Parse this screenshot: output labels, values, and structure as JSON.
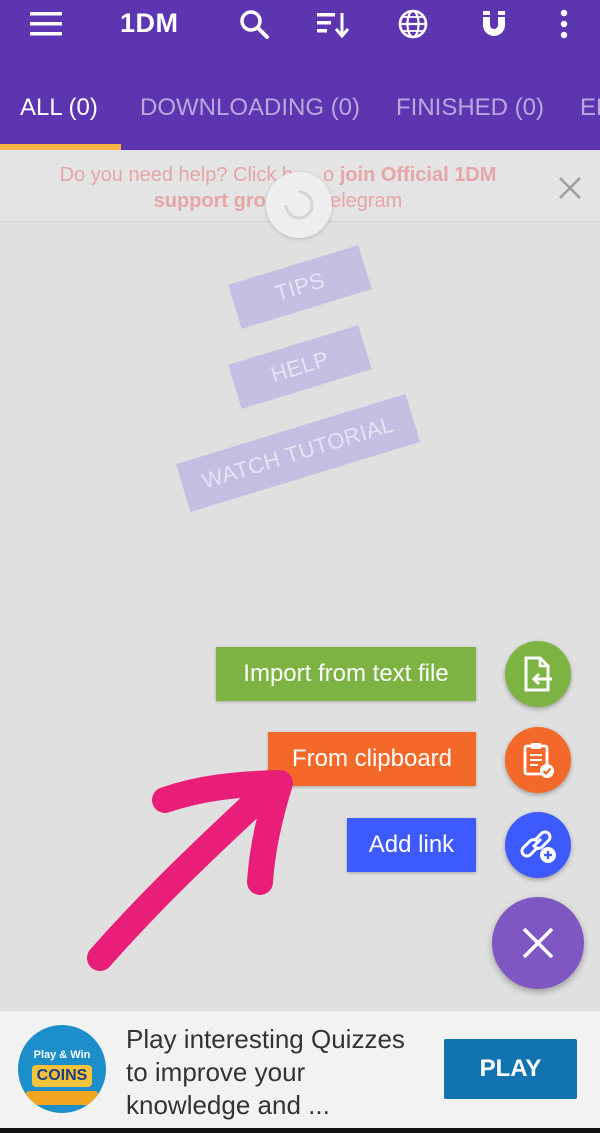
{
  "toolbar": {
    "title": "1DM",
    "icons": [
      "menu-icon",
      "search-icon",
      "sort-icon",
      "browser-globe-icon",
      "magnet-icon",
      "more-vert-icon"
    ]
  },
  "tabs": [
    {
      "label": "ALL (0)",
      "active": true
    },
    {
      "label": "DOWNLOADING (0)",
      "active": false
    },
    {
      "label": "FINISHED (0)",
      "active": false
    },
    {
      "label": "ER",
      "active": false
    }
  ],
  "banner": {
    "text_line1_normal": "Do you need help? Click h",
    "text_line1_mid": "o",
    "text_line1_bold": "join Official 1DM",
    "text_line2_bold": "support grou",
    "text_line2_normal": "elegram"
  },
  "empty_state": {
    "tips": "TIPS",
    "help": "HELP",
    "tutorial": "WATCH TUTORIAL"
  },
  "fab_menu": {
    "import_label": "Import from text file",
    "clipboard_label": "From clipboard",
    "add_link_label": "Add link"
  },
  "ad": {
    "logo_top": "Play & Win",
    "logo_coins": "COINS",
    "text": "Play interesting Quizzes to improve your knowledge and ...",
    "button": "PLAY"
  },
  "colors": {
    "appbar": "#5e35b1",
    "tab_indicator": "#f5b342",
    "import": "#7cb342",
    "clipboard": "#f4692a",
    "add_link": "#3d5afe",
    "fab_main": "#7e57c2",
    "arrow": "#e91e79",
    "ad_button": "#1174b1"
  }
}
